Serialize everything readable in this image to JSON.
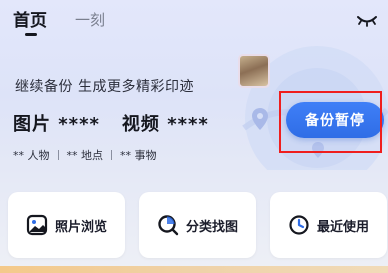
{
  "tabs": {
    "home": "首页",
    "moment": "一刻"
  },
  "backup": {
    "subtitle": "继续备份 生成更多精彩印迹",
    "photos": "图片 ****",
    "videos": "视频 ****",
    "tags": [
      "** 人物",
      "** 地点",
      "** 事物"
    ],
    "pause_label": "备份暂停"
  },
  "shortcuts": [
    {
      "label": "照片浏览",
      "icon": "photo-icon"
    },
    {
      "label": "分类找图",
      "icon": "search-icon"
    },
    {
      "label": "最近使用",
      "icon": "clock-icon"
    }
  ],
  "colors": {
    "accent": "#2f6de6",
    "highlight": "#ef1e1e",
    "text": "#15171f"
  }
}
